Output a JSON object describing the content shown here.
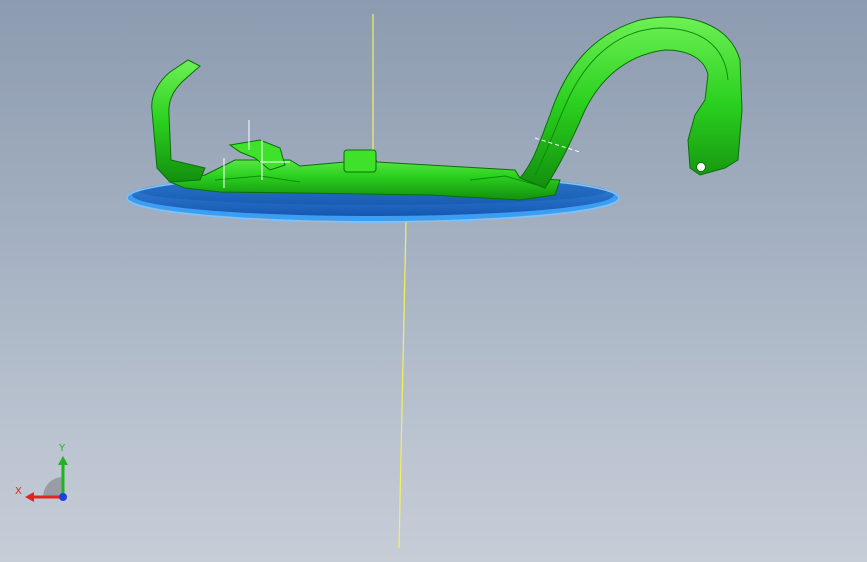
{
  "window": {
    "type": "cad-3d-viewport"
  },
  "colors": {
    "background_top": "#8d9bb0",
    "background_bottom": "#c6cdd7",
    "part_green": "#2bd11f",
    "part_green_dark": "#0f8a0b",
    "disc_blue": "#1f6fc9",
    "disc_rim": "#3b9ef2",
    "axis_line": "#f2f25a"
  },
  "triad": {
    "x_label": "X",
    "y_label": "Y",
    "x_color": "#e0261f",
    "y_color": "#1fb31f",
    "z_color": "#1f3fe0"
  },
  "icons": {
    "triad": "coordinate-triad-icon"
  }
}
